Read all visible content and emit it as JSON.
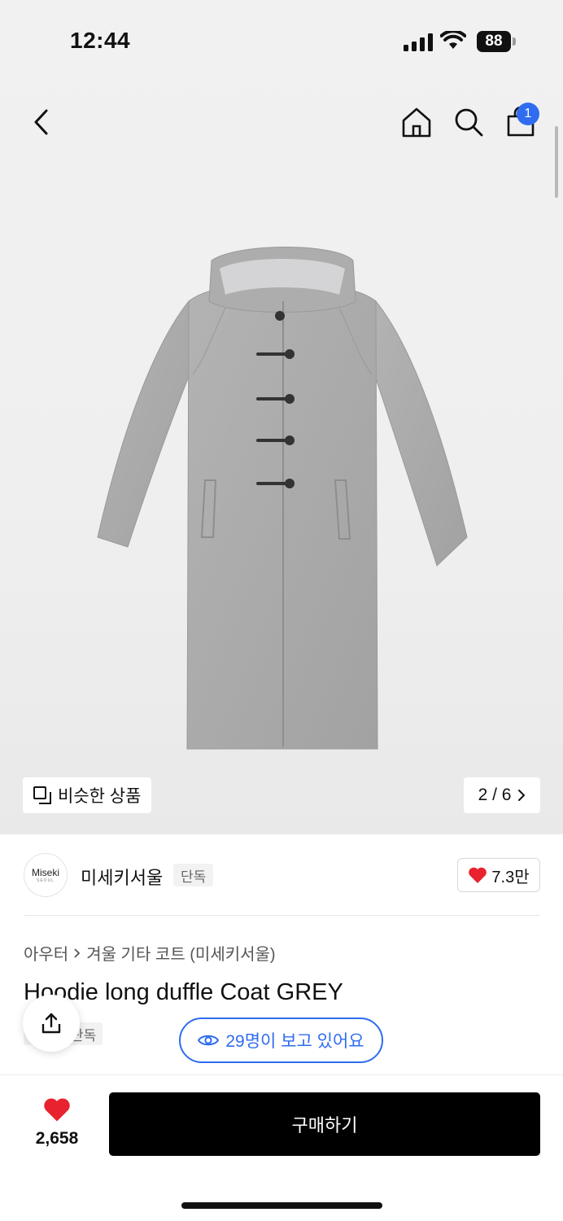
{
  "status_bar": {
    "time": "12:44",
    "battery": "88"
  },
  "header": {
    "back_icon": "chevron-left-icon",
    "home_icon": "home-icon",
    "search_icon": "search-icon",
    "cart_icon": "shopping-bag-icon",
    "cart_count": "1"
  },
  "gallery": {
    "similar_label": "비슷한 상품",
    "page_indicator": "2 / 6"
  },
  "brand": {
    "logo_text": "Miseki",
    "logo_sub": "SEOUL",
    "name": "미세키서울",
    "tag": "단독",
    "like_count": "7.3만"
  },
  "product": {
    "breadcrumb": [
      "아우터",
      "겨울 기타 코트 (미세키서울)"
    ],
    "title": "Hoodie long duffle Coat GREY",
    "tag": "단독",
    "viewers_text": "29명이 보고 있어요"
  },
  "bottom": {
    "wish_count": "2,658",
    "buy_label": "구매하기"
  },
  "colors": {
    "accent": "#2f6cf0",
    "heart": "#e8232f",
    "buy_button": "#000000"
  }
}
